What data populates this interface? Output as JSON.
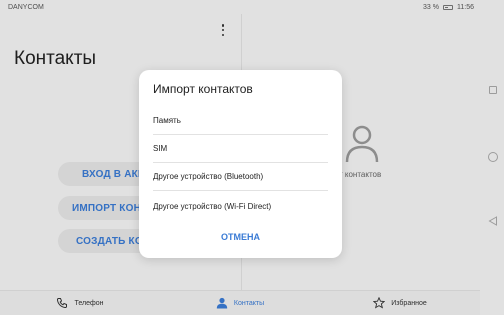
{
  "status": {
    "carrier": "DANYCOM",
    "battery_percent": "33 %",
    "time": "11:56"
  },
  "header": {
    "title": "Контакты"
  },
  "left_buttons": {
    "login": "ВХОД В АККА",
    "import": "ИМПОРТ КОНТ",
    "create": "СОЗДАТЬ КОН"
  },
  "empty_state": {
    "text": "т контактов"
  },
  "dialog": {
    "title": "Импорт контактов",
    "items": [
      "Память",
      "SIM",
      "Другое устройство (Bluetooth)",
      "Другое устройство (Wi-Fi Direct)"
    ],
    "cancel": "ОТМЕНА"
  },
  "bottom_nav": {
    "phone": "Телефон",
    "contacts": "Контакты",
    "favorites": "Избранное"
  },
  "colors": {
    "accent": "#3a7bd5"
  }
}
